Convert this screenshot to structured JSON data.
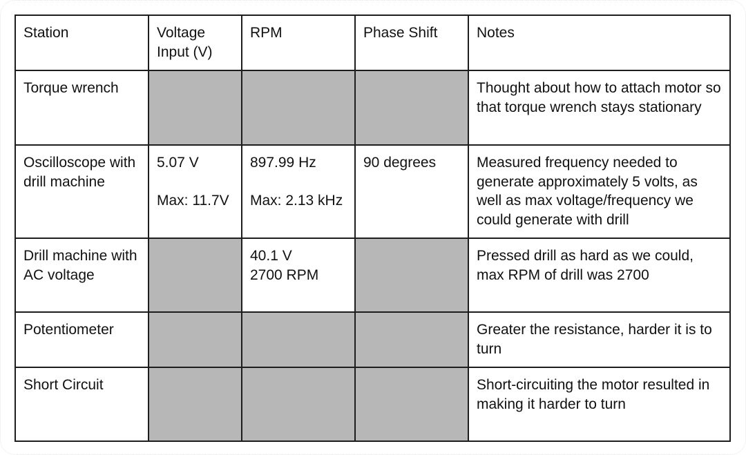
{
  "table": {
    "headers": [
      "Station",
      "Voltage Input (V)",
      "RPM",
      "Phase Shift",
      "Notes"
    ],
    "rows": [
      {
        "station": "Torque wrench",
        "voltage": "",
        "rpm": "",
        "phase_shift": "",
        "notes": "Thought about how to attach motor so that torque wrench stays stationary",
        "empty_cells": [
          "voltage",
          "rpm",
          "phase_shift"
        ]
      },
      {
        "station": "Oscilloscope with drill machine",
        "voltage": "5.07 V",
        "voltage_max": "Max: 11.7V",
        "rpm": "897.99 Hz",
        "rpm_max": "Max: 2.13 kHz",
        "phase_shift": "90 degrees",
        "notes": "Measured frequency needed to generate approximately 5 volts, as well as max voltage/frequency we could generate with drill",
        "empty_cells": []
      },
      {
        "station": "Drill machine with AC voltage",
        "voltage": "",
        "rpm": "40.1 V",
        "rpm_line2": "2700 RPM",
        "phase_shift": "",
        "notes": "Pressed drill as hard as we could, max RPM of drill was 2700",
        "empty_cells": [
          "voltage",
          "phase_shift"
        ]
      },
      {
        "station": "Potentiometer",
        "voltage": "",
        "rpm": "",
        "phase_shift": "",
        "notes": "Greater the resistance, harder it is to turn",
        "empty_cells": [
          "voltage",
          "rpm",
          "phase_shift"
        ]
      },
      {
        "station": "Short Circuit",
        "voltage": "",
        "rpm": "",
        "phase_shift": "",
        "notes": "Short-circuiting the motor resulted in making it harder to turn",
        "empty_cells": [
          "voltage",
          "rpm",
          "phase_shift"
        ]
      }
    ]
  },
  "colors": {
    "empty_cell": "#b7b7b7",
    "border": "#1c1c1c",
    "text": "#111111"
  }
}
